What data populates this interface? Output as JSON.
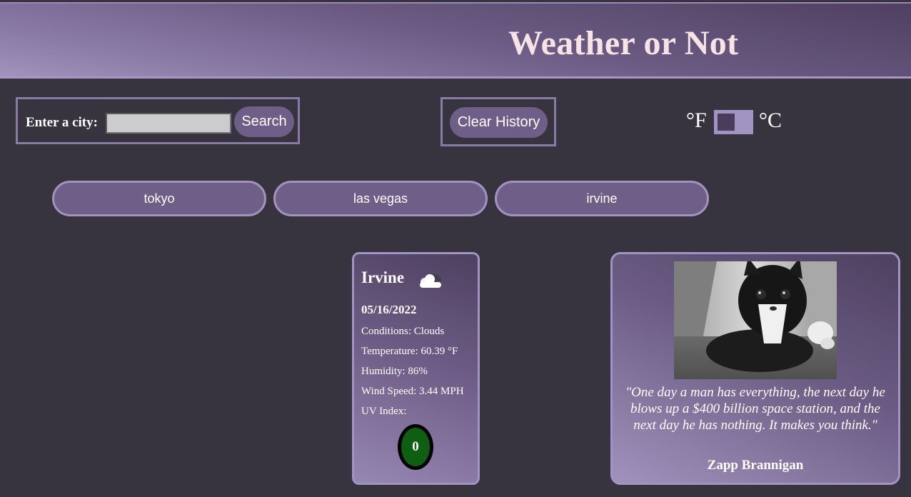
{
  "header": {
    "title": "Weather or Not"
  },
  "search": {
    "label": "Enter a city:",
    "input_value": "",
    "button_label": "Search"
  },
  "history_controls": {
    "clear_label": "Clear History"
  },
  "units": {
    "fahrenheit": "°F",
    "celsius": "°C",
    "selected": "°F"
  },
  "history": [
    {
      "label": "tokyo"
    },
    {
      "label": "las vegas"
    },
    {
      "label": "irvine"
    }
  ],
  "weather": {
    "city": "Irvine",
    "icon": "cloud-icon",
    "date": "05/16/2022",
    "conditions": "Conditions: Clouds",
    "temperature": "Temperature: 60.39 °F",
    "humidity": "Humidity: 86%",
    "wind": "Wind Speed: 3.44 MPH",
    "uv_label": "UV Index:",
    "uv_value": "0",
    "uv_color": "#0f5f12"
  },
  "quote": {
    "text": "\"One day a man has everything, the next day he blows up a $400 billion space station, and the next day he has nothing. It makes you think.\"",
    "author": "Zapp Brannigan",
    "image": "black-and-white-cat-photo"
  },
  "colors": {
    "background": "#38343f",
    "accent": "#6f5e87",
    "border": "#a193bd",
    "title": "#f7e3e6"
  }
}
